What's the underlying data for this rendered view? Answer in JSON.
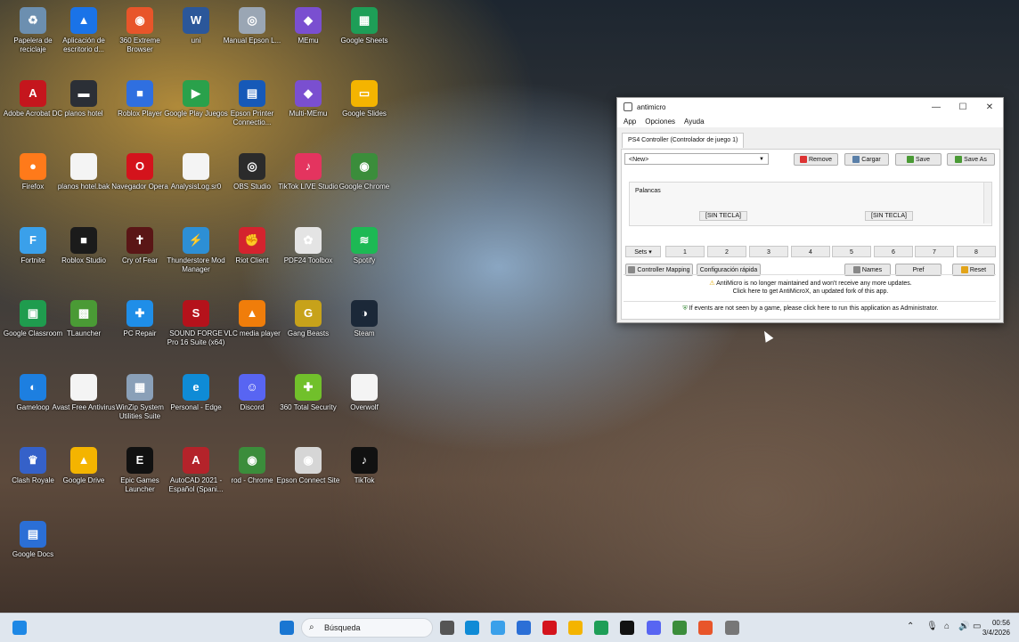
{
  "desktop_icons": [
    {
      "label": "Papelera de reciclaje",
      "color": "#6c8fb0",
      "glyph": "♻"
    },
    {
      "label": "Aplicación de escritorio d...",
      "color": "#1a73e8",
      "glyph": "▲"
    },
    {
      "label": "360 Extreme Browser",
      "color": "#e8552a",
      "glyph": "◉"
    },
    {
      "label": "uni",
      "color": "#2b579a",
      "glyph": "W"
    },
    {
      "label": "Manual Epson L...",
      "color": "#9aa6b4",
      "glyph": "◎"
    },
    {
      "label": "MEmu",
      "color": "#7a4fd0",
      "glyph": "◆"
    },
    {
      "label": "Google Sheets",
      "color": "#1e9e57",
      "glyph": "▦"
    },
    {
      "label": "Adobe Acrobat DC",
      "color": "#c5161d",
      "glyph": "A"
    },
    {
      "label": "planos hotel",
      "color": "#2b2f36",
      "glyph": "▬"
    },
    {
      "label": "Roblox Player",
      "color": "#2f6fe0",
      "glyph": "■"
    },
    {
      "label": "Google Play Juegos",
      "color": "#2aa14b",
      "glyph": "▶"
    },
    {
      "label": "Epson Printer Connectio...",
      "color": "#1659b8",
      "glyph": "▤"
    },
    {
      "label": "Multi-MEmu",
      "color": "#7a4fd0",
      "glyph": "◆"
    },
    {
      "label": "Google Slides",
      "color": "#f4b400",
      "glyph": "▭"
    },
    {
      "label": "Firefox",
      "color": "#ff7a1a",
      "glyph": "●"
    },
    {
      "label": "planos hotel.bak",
      "color": "#f4f4f4",
      "glyph": " "
    },
    {
      "label": "Navegador Opera",
      "color": "#d4131c",
      "glyph": "O"
    },
    {
      "label": "AnalysisLog.sr0",
      "color": "#f4f4f4",
      "glyph": " "
    },
    {
      "label": "OBS Studio",
      "color": "#2b2b2b",
      "glyph": "◎"
    },
    {
      "label": "TikTok LIVE Studio",
      "color": "#e4345f",
      "glyph": "♪"
    },
    {
      "label": "Google Chrome",
      "color": "#3b8d3b",
      "glyph": "◉"
    },
    {
      "label": "Fortnite",
      "color": "#3aa0ea",
      "glyph": "F"
    },
    {
      "label": "Roblox Studio",
      "color": "#1b1b1b",
      "glyph": "■"
    },
    {
      "label": "Cry of Fear",
      "color": "#5a1616",
      "glyph": "✝"
    },
    {
      "label": "Thunderstore Mod Manager",
      "color": "#2d8fd5",
      "glyph": "⚡"
    },
    {
      "label": "Riot Client",
      "color": "#d4232e",
      "glyph": "✊"
    },
    {
      "label": "PDF24 Toolbox",
      "color": "#e4e4e4",
      "glyph": "✿"
    },
    {
      "label": "Spotify",
      "color": "#1db954",
      "glyph": "≋"
    },
    {
      "label": "Google Classroom",
      "color": "#1f9c4e",
      "glyph": "▣"
    },
    {
      "label": "TLauncher",
      "color": "#4a9a35",
      "glyph": "▩"
    },
    {
      "label": "PC Repair",
      "color": "#1f8ee8",
      "glyph": "✚"
    },
    {
      "label": "SOUND FORGE Pro 16 Suite (x64)",
      "color": "#b5121b",
      "glyph": "S"
    },
    {
      "label": "VLC media player",
      "color": "#f07d0a",
      "glyph": "▲"
    },
    {
      "label": "Gang Beasts",
      "color": "#c7a21a",
      "glyph": "G"
    },
    {
      "label": "Steam",
      "color": "#1b2838",
      "glyph": "◑"
    },
    {
      "label": "Gameloop",
      "color": "#1d7fe0",
      "glyph": "◐"
    },
    {
      "label": "Avast Free Antivirus",
      "color": "#f4f4f4",
      "glyph": " "
    },
    {
      "label": "WinZip System Utilities Suite",
      "color": "#8aa0b8",
      "glyph": "▦"
    },
    {
      "label": "Personal - Edge",
      "color": "#0f8bd6",
      "glyph": "e"
    },
    {
      "label": "Discord",
      "color": "#5865f2",
      "glyph": "☺"
    },
    {
      "label": "360 Total Security",
      "color": "#71c02b",
      "glyph": "✚"
    },
    {
      "label": "Overwolf",
      "color": "#f4f4f4",
      "glyph": " "
    },
    {
      "label": "Clash Royale",
      "color": "#3561c9",
      "glyph": "♛"
    },
    {
      "label": "Google Drive",
      "color": "#f4b400",
      "glyph": "▲"
    },
    {
      "label": "Epic Games Launcher",
      "color": "#111111",
      "glyph": "E"
    },
    {
      "label": "AutoCAD 2021 - Español (Spani...",
      "color": "#b4232a",
      "glyph": "A"
    },
    {
      "label": "rod - Chrome",
      "color": "#3b8d3b",
      "glyph": "◉"
    },
    {
      "label": "Epson Connect Site",
      "color": "#d6d6d6",
      "glyph": "◉"
    },
    {
      "label": "TikTok",
      "color": "#111111",
      "glyph": "♪"
    },
    {
      "label": "Google Docs",
      "color": "#2b6fd6",
      "glyph": "▤"
    }
  ],
  "window": {
    "title": "antimicro",
    "menu": [
      "App",
      "Opciones",
      "Ayuda"
    ],
    "tab_label": "PS4 Controller (Controlador de juego 1)",
    "profile_select": "<New>",
    "buttons": {
      "remove": "Remove",
      "load": "Cargar",
      "save": "Save",
      "save_as": "Save As"
    },
    "sticks_header": "Palancas",
    "stick_left": "[SIN TECLA]",
    "stick_right": "[SIN TECLA]",
    "sets_label": "Sets",
    "set_numbers": [
      "1",
      "2",
      "3",
      "4",
      "5",
      "6",
      "7",
      "8"
    ],
    "controller_mapping": "Controller Mapping",
    "quick_config": "Configuración rápida",
    "names": "Names",
    "pref": "Pref",
    "reset": "Reset",
    "notice_line1": "AntiMicro is no longer maintained and won't receive any more updates.",
    "notice_line2": "Click here to get AntiMicroX, an updated fork of this app.",
    "notice_admin": "If events are not seen by a game, please click here to run this application as Administrator."
  },
  "taskbar": {
    "search_placeholder": "Búsqueda",
    "time": "00:56",
    "date": "3/4/2026"
  }
}
